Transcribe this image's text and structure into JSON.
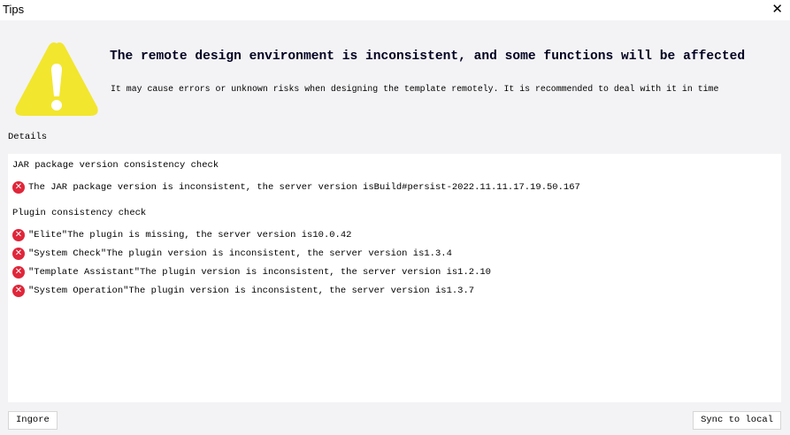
{
  "window": {
    "title": "Tips",
    "close_icon": "close-icon"
  },
  "header": {
    "headline": "The remote design environment is inconsistent, and some functions will be affected",
    "subtext": "It may cause errors or unknown risks when designing the template remotely. It is recommended to deal with it in time",
    "icon": "warning-icon"
  },
  "details": {
    "label": "Details",
    "jar_section": {
      "title": "JAR package version consistency check",
      "items": [
        "The JAR package version is inconsistent, the server version isBuild#persist-2022.11.11.17.19.50.167"
      ]
    },
    "plugin_section": {
      "title": "Plugin consistency check",
      "items": [
        "\"Elite\"The plugin is missing, the server version is10.0.42",
        "\"System Check\"The plugin version is inconsistent, the server version is1.3.4",
        "\"Template Assistant\"The plugin version is inconsistent, the server version is1.2.10",
        "\"System Operation\"The plugin version is inconsistent, the server version is1.3.7"
      ]
    }
  },
  "buttons": {
    "ignore": "Ingore",
    "sync": "Sync to local"
  },
  "colors": {
    "warning": "#f2e62e",
    "error": "#e0263a"
  }
}
